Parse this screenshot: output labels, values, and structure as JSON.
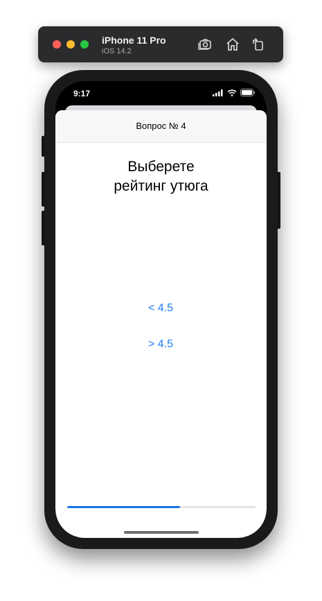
{
  "simulator": {
    "device_name": "iPhone 11 Pro",
    "os_version": "iOS 14.2",
    "buttons": [
      "screenshot-icon",
      "home-icon",
      "rotate-icon"
    ]
  },
  "status_bar": {
    "time": "9:17"
  },
  "nav": {
    "title": "Вопрос № 4"
  },
  "question": {
    "text": "Выберете\nрейтинг утюга"
  },
  "answers": [
    {
      "label": "< 4.5"
    },
    {
      "label": "> 4.5"
    }
  ],
  "progress": {
    "value": 0.6,
    "fill_color": "#1a74e8",
    "track_color": "#e3e3e7"
  },
  "colors": {
    "accent": "#1f7cf2"
  }
}
